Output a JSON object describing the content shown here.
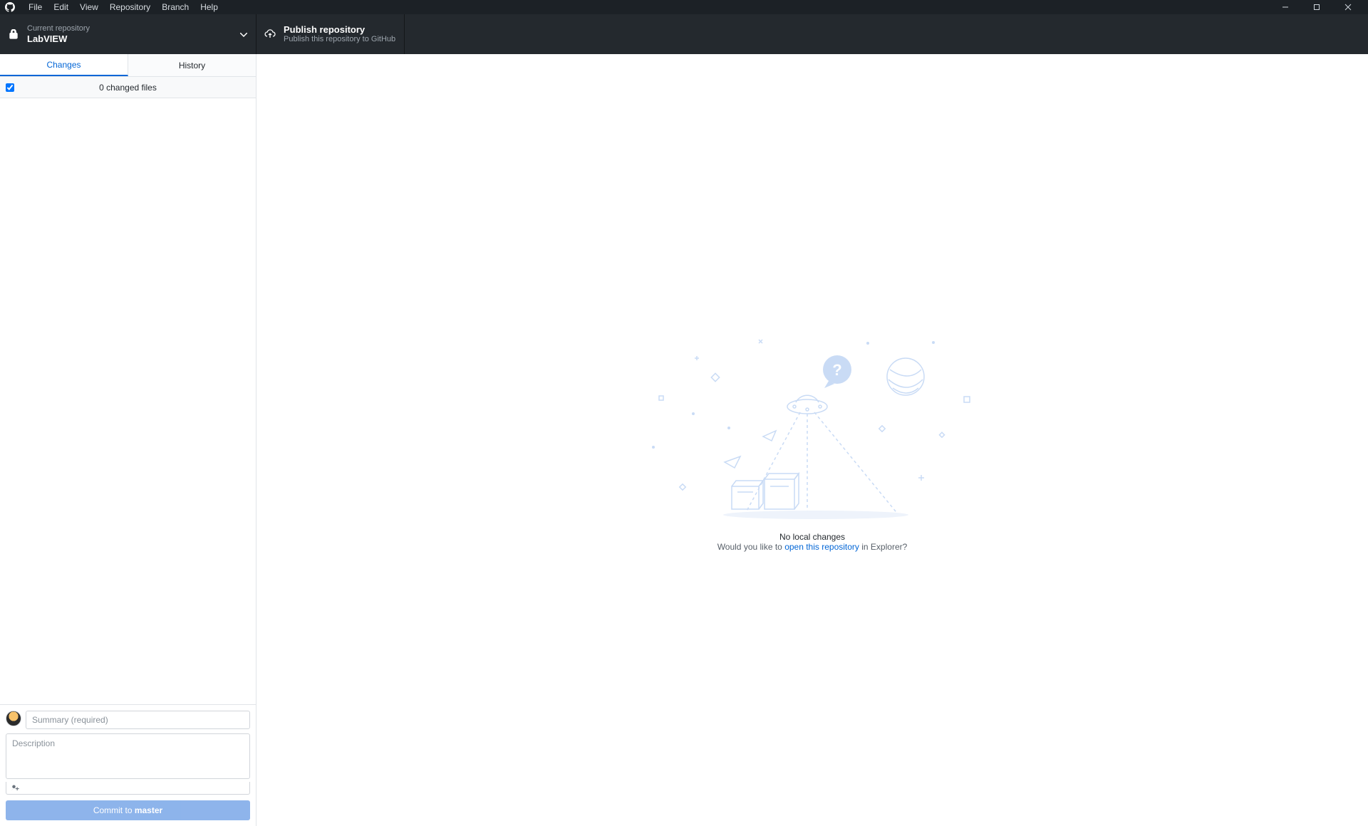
{
  "titlebar": {
    "menu": [
      "File",
      "Edit",
      "View",
      "Repository",
      "Branch",
      "Help"
    ]
  },
  "toolbar": {
    "repo": {
      "label": "Current repository",
      "name": "LabVIEW"
    },
    "publish": {
      "title": "Publish repository",
      "subtitle": "Publish this repository to GitHub"
    }
  },
  "sidebar": {
    "tabs": {
      "changes": "Changes",
      "history": "History"
    },
    "files_header": "0 changed files",
    "commit": {
      "summary_placeholder": "Summary (required)",
      "description_placeholder": "Description",
      "button_prefix": "Commit to ",
      "button_branch": "master"
    }
  },
  "empty": {
    "title": "No local changes",
    "prefix": "Would you like to ",
    "link": "open this repository",
    "suffix": " in Explorer?"
  }
}
